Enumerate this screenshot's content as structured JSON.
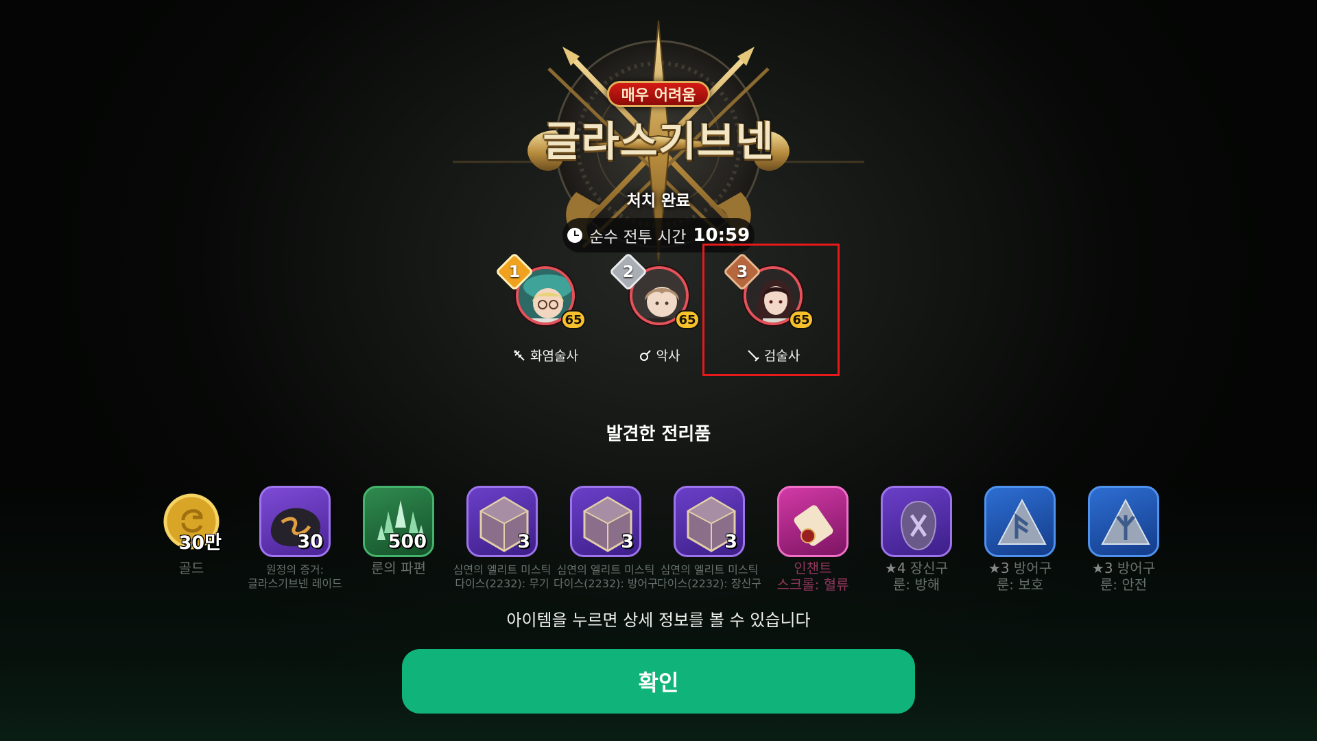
{
  "emblem": {
    "difficulty": "매우 어려움",
    "boss_name": "글라스기브넨",
    "status": "처치 완료",
    "battle_time_label": "순수 전투 시간",
    "battle_time_value": "10:59"
  },
  "party": [
    {
      "rank": "1",
      "level": "65",
      "class": "화염술사",
      "rank_color": "#f0a21e",
      "icon": "fire-staff-icon"
    },
    {
      "rank": "2",
      "level": "65",
      "class": "악사",
      "rank_color": "#a9aeb4",
      "icon": "lute-icon"
    },
    {
      "rank": "3",
      "level": "65",
      "class": "검술사",
      "rank_color": "#b7673e",
      "icon": "sword-icon"
    }
  ],
  "loot_heading": "발견한 전리품",
  "loot": [
    {
      "qty": "30만",
      "name_line1": "골드",
      "name_line2": "",
      "icon": "gold-coin-icon"
    },
    {
      "qty": "30",
      "name_line1": "원정의 증거:",
      "name_line2": "글라스기브넨 레이드",
      "icon": "raid-proof-icon"
    },
    {
      "qty": "500",
      "name_line1": "룬의 파편",
      "name_line2": "",
      "icon": "rune-shard-icon"
    },
    {
      "qty": "3",
      "name_line1": "심연의 엘리트 미스틱",
      "name_line2": "다이스(2232): 무기",
      "icon": "dice-icon"
    },
    {
      "qty": "3",
      "name_line1": "심연의 엘리트 미스틱",
      "name_line2": "다이스(2232): 방어구",
      "icon": "dice-icon"
    },
    {
      "qty": "3",
      "name_line1": "심연의 엘리트 미스틱",
      "name_line2": "다이스(2232): 장신구",
      "icon": "dice-icon"
    },
    {
      "qty": "",
      "name_line1": "인챈트",
      "name_line2": "스크롤: 혈류",
      "icon": "enchant-scroll-icon"
    },
    {
      "qty": "",
      "star": "★4",
      "name_line1": " 장신구",
      "name_line2": "룬: 방해",
      "icon": "purple-rune-icon"
    },
    {
      "qty": "",
      "star": "★3",
      "name_line1": " 방어구",
      "name_line2": "룬: 보호",
      "icon": "blue-rune-icon"
    },
    {
      "qty": "",
      "star": "★3",
      "name_line1": " 방어구",
      "name_line2": "룬: 안전",
      "icon": "blue-rune-icon"
    }
  ],
  "hint": "아이템을 누르면 상세 정보를 볼 수 있습니다",
  "confirm_label": "확인",
  "colors": {
    "confirm": "#10b47a",
    "highlight": "#e8191a",
    "level_badge": "#f6c12a",
    "difficulty": "#d41a14"
  }
}
